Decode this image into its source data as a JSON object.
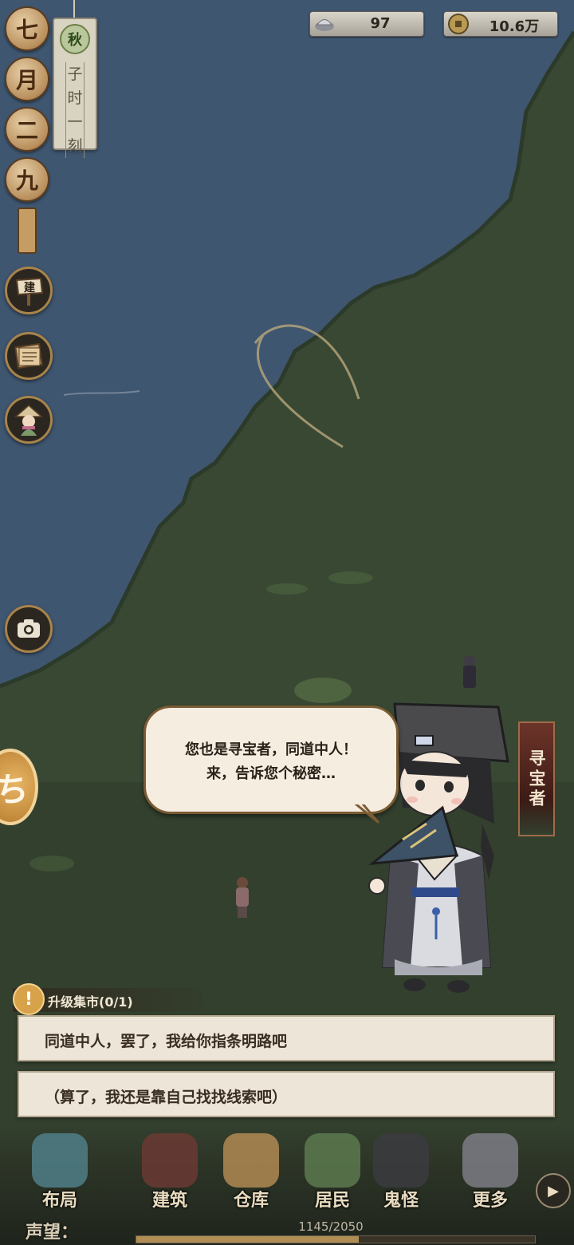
{
  "calendar": {
    "month_chars": [
      "七",
      "月",
      "二",
      "九"
    ],
    "season": "秋",
    "time_chars": [
      "子",
      "时",
      "一",
      "刻"
    ]
  },
  "resources": {
    "silver": {
      "icon": "silver-ingot-icon",
      "value": "97"
    },
    "coins": {
      "icon": "copper-coin-icon",
      "value": "10.6万"
    }
  },
  "side_buttons": {
    "build": {
      "icon": "build-sign-icon",
      "glyph": "建"
    },
    "scroll": {
      "icon": "scroll-book-icon"
    },
    "character": {
      "icon": "villager-portrait-icon"
    },
    "camera": {
      "icon": "camera-icon"
    }
  },
  "dialog": {
    "text": "您也是寻宝者，同道中人！\n来，告诉您个秘密…",
    "npc_name": "寻宝者"
  },
  "task": {
    "label": "升级集市(0/1)",
    "icon": "exclamation-icon"
  },
  "choices": [
    {
      "text": "同道中人，罢了，我给你指条明路吧"
    },
    {
      "text": "（算了，我还是靠自己找找线索吧）"
    }
  ],
  "nav": [
    {
      "label": "布局",
      "icon": "layout-icon"
    },
    {
      "label": "建筑",
      "icon": "building-icon"
    },
    {
      "label": "仓库",
      "icon": "warehouse-icon"
    },
    {
      "label": "居民",
      "icon": "resident-icon"
    },
    {
      "label": "鬼怪",
      "icon": "ghost-icon"
    },
    {
      "label": "更多",
      "icon": "more-icon"
    }
  ],
  "reputation": {
    "label": "声望：",
    "current": 1145,
    "max": 2050,
    "text": "1145/2050"
  },
  "colors": {
    "water": "#3f5670",
    "grass": "#3a4a33",
    "accent": "#a8844a"
  }
}
